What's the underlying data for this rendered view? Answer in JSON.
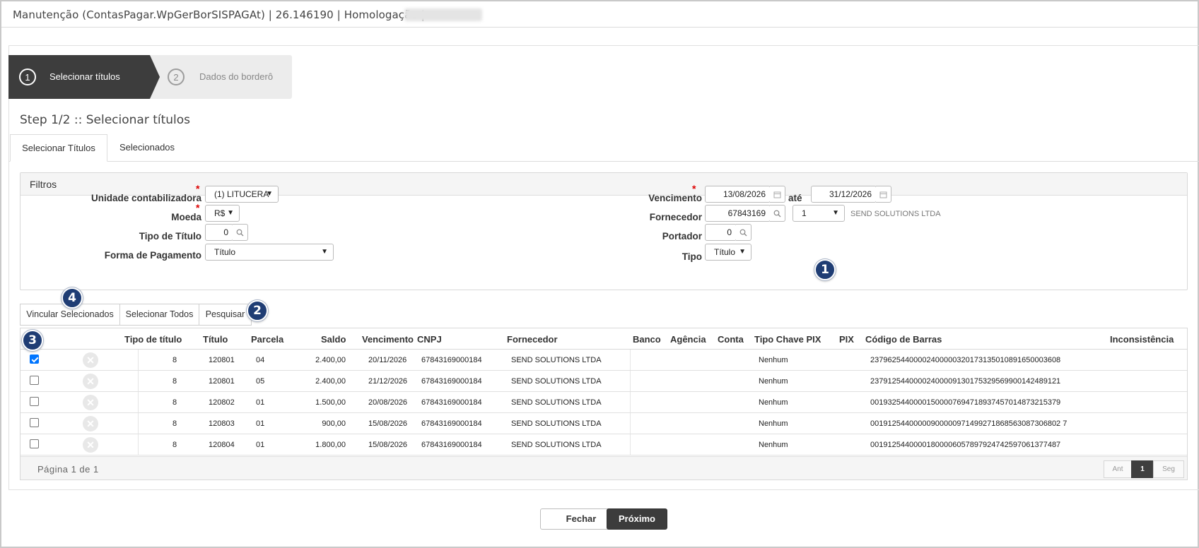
{
  "window": {
    "title": "Manutenção (ContasPagar.WpGerBorSISPAGAt) | 26.146190 | Homologação |"
  },
  "wizard": {
    "steps": [
      {
        "number": "1",
        "label": "Selecionar títulos"
      },
      {
        "number": "2",
        "label": "Dados do borderô"
      }
    ]
  },
  "page_title": "Step 1/2 :: Selecionar títulos",
  "tabs": [
    {
      "label": "Selecionar Títulos",
      "active": true
    },
    {
      "label": "Selecionados",
      "active": false
    }
  ],
  "filtros": {
    "title": "Filtros",
    "required_mark": "*",
    "unidade": {
      "label": "Unidade contabilizadora",
      "value": "(1) LITUCERA"
    },
    "moeda": {
      "label": "Moeda",
      "value": "R$"
    },
    "tipo_titulo": {
      "label": "Tipo de Título",
      "value": "0"
    },
    "forma_pagamento": {
      "label": "Forma de Pagamento",
      "value": "Título"
    },
    "vencimento": {
      "label": "Vencimento",
      "from": "13/08/2026",
      "separator": "até",
      "to": "31/12/2026"
    },
    "fornecedor": {
      "label": "Fornecedor",
      "code": "67843169",
      "loja": "1",
      "name": "SEND SOLUTIONS LTDA"
    },
    "portador": {
      "label": "Portador",
      "value": "0"
    },
    "tipo": {
      "label": "Tipo",
      "value": "Título"
    }
  },
  "actions": {
    "vincular": "Vincular Selecionados",
    "selecionar_todos": "Selecionar Todos",
    "pesquisar": "Pesquisar"
  },
  "callouts": [
    "1",
    "2",
    "3",
    "4"
  ],
  "grid": {
    "columns": [
      "Tipo de título",
      "Título",
      "Parcela",
      "Saldo",
      "Vencimento",
      "CNPJ",
      "Fornecedor",
      "Banco",
      "Agência",
      "Conta",
      "Tipo Chave PIX",
      "PIX",
      "Código de Barras",
      "Inconsistência"
    ],
    "rows": [
      {
        "checked": true,
        "tipo": "8",
        "titulo": "120801",
        "parcela": "04",
        "saldo": "2.400,00",
        "vencimento": "20/11/2026",
        "cnpj": "67843169000184",
        "fornecedor": "SEND SOLUTIONS LTDA",
        "banco": "",
        "agencia": "",
        "conta": "",
        "tipo_chave_pix": "Nenhum",
        "pix": "",
        "codigo_barras": "23796254400002400000320173135010891650003608",
        "inconsistencia": ""
      },
      {
        "checked": false,
        "tipo": "8",
        "titulo": "120801",
        "parcela": "05",
        "saldo": "2.400,00",
        "vencimento": "21/12/2026",
        "cnpj": "67843169000184",
        "fornecedor": "SEND SOLUTIONS LTDA",
        "banco": "",
        "agencia": "",
        "conta": "",
        "tipo_chave_pix": "Nenhum",
        "pix": "",
        "codigo_barras": "23791254400002400009130175329569900142489121",
        "inconsistencia": ""
      },
      {
        "checked": false,
        "tipo": "8",
        "titulo": "120802",
        "parcela": "01",
        "saldo": "1.500,00",
        "vencimento": "20/08/2026",
        "cnpj": "67843169000184",
        "fornecedor": "SEND SOLUTIONS LTDA",
        "banco": "",
        "agencia": "",
        "conta": "",
        "tipo_chave_pix": "Nenhum",
        "pix": "",
        "codigo_barras": "00193254400001500007694718937457014873215379",
        "inconsistencia": ""
      },
      {
        "checked": false,
        "tipo": "8",
        "titulo": "120803",
        "parcela": "01",
        "saldo": "900,00",
        "vencimento": "15/08/2026",
        "cnpj": "67843169000184",
        "fornecedor": "SEND SOLUTIONS LTDA",
        "banco": "",
        "agencia": "",
        "conta": "",
        "tipo_chave_pix": "Nenhum",
        "pix": "",
        "codigo_barras": "00191254400000900000971499271868563087306802 7",
        "inconsistencia": ""
      },
      {
        "checked": false,
        "tipo": "8",
        "titulo": "120804",
        "parcela": "01",
        "saldo": "1.800,00",
        "vencimento": "15/08/2026",
        "cnpj": "67843169000184",
        "fornecedor": "SEND SOLUTIONS LTDA",
        "banco": "",
        "agencia": "",
        "conta": "",
        "tipo_chave_pix": "Nenhum",
        "pix": "",
        "codigo_barras": "00191254400001800006057897924742597061377487",
        "inconsistencia": ""
      }
    ],
    "pagination": {
      "text": "Página 1 de 1",
      "prev": "Ant",
      "current": "1",
      "next": "Seg"
    }
  },
  "footer": {
    "fechar": "Fechar",
    "proximo": "Próximo"
  },
  "colors": {
    "wizard_active": "#3d3d3d",
    "callout": "#1f3d74",
    "checkbox": "#0075ff",
    "required": "#d00000"
  }
}
